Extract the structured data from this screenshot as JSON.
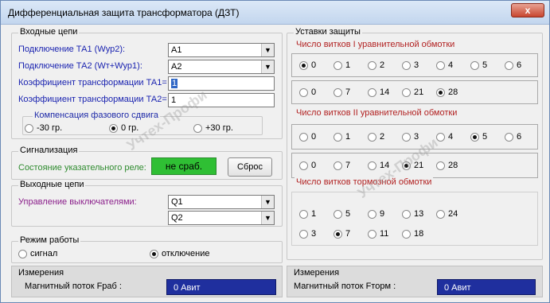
{
  "window": {
    "title": "Дифференциальная защита трансформатора (ДЗТ)",
    "close_glyph": "x"
  },
  "inputs": {
    "legend": "Входные цепи",
    "ta1": {
      "label": "Подключение ТА1 (Wур2):",
      "value": "A1"
    },
    "ta2": {
      "label": "Подключение ТА2 (Wт+Wур1):",
      "value": "A2"
    },
    "k1": {
      "label": "Коэффициент трансформации ТА1=",
      "value": "1"
    },
    "k2": {
      "label": "Коэффициент трансформации ТА2=",
      "value": "1"
    },
    "phase": {
      "legend": "Компенсация фазового сдвига",
      "options": [
        "-30 гр.",
        "0 гр.",
        "+30 гр."
      ],
      "selected": 1
    }
  },
  "signal": {
    "legend": "Сигнализация",
    "label": "Состояние указательного реле:",
    "status": "не сраб.",
    "reset": "Сброс"
  },
  "outputs": {
    "legend": "Выходные цепи",
    "label": "Управление выключателями:",
    "q1": "Q1",
    "q2": "Q2"
  },
  "mode": {
    "legend": "Режим работы",
    "options": [
      "сигнал",
      "отключение"
    ],
    "selected": 1
  },
  "meas_left": {
    "legend": "Измерения",
    "label": "Магнитный поток Fраб :",
    "value": "0 Авит"
  },
  "meas_right": {
    "legend": "Измерения",
    "label": "Магнитный поток Fторм :",
    "value": "0 Авит"
  },
  "settings": {
    "legend": "Уставки защиты",
    "w1": {
      "legend": "Число витков I уравнительной обмотки",
      "row1": [
        "0",
        "1",
        "2",
        "3",
        "4",
        "5",
        "6"
      ],
      "row2": [
        "0",
        "7",
        "14",
        "21",
        "28"
      ],
      "sel1": 0,
      "sel2": 4
    },
    "w2": {
      "legend": "Число витков II уравнительной обмотки",
      "row1": [
        "0",
        "1",
        "2",
        "3",
        "4",
        "5",
        "6"
      ],
      "row2": [
        "0",
        "7",
        "14",
        "21",
        "28"
      ],
      "sel1": 5,
      "sel2": 3
    },
    "wt": {
      "legend": "Число витков тормозной обмотки",
      "row1": [
        "1",
        "5",
        "9",
        "13",
        "24"
      ],
      "row2": [
        "3",
        "7",
        "11",
        "18"
      ],
      "sel1": -1,
      "sel2": 1
    }
  },
  "watermark": "Учтех-Профи"
}
